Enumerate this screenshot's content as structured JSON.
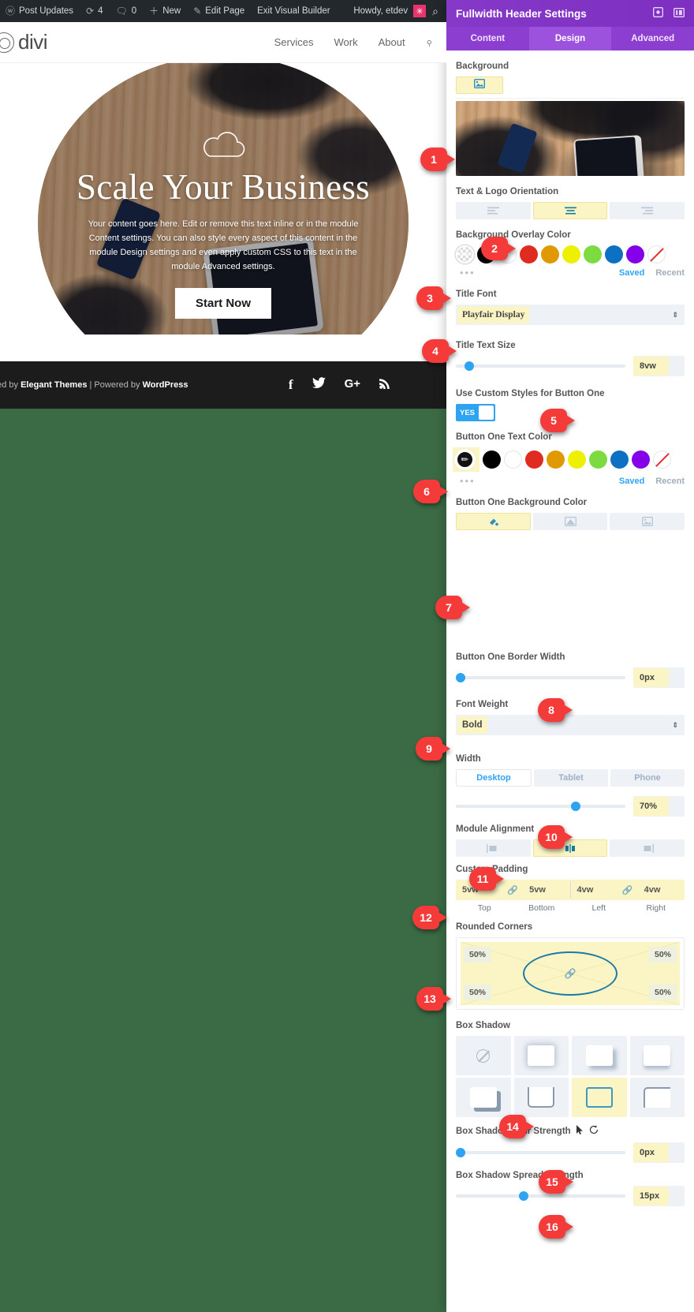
{
  "adminbar": {
    "items": [
      {
        "icon": "wordpress-logo-icon",
        "label": "Post Updates"
      },
      {
        "icon": "updates-icon",
        "label": "4"
      },
      {
        "icon": "comments-icon",
        "label": "0"
      },
      {
        "icon": "plus-icon",
        "label": "New"
      },
      {
        "icon": "pencil-icon",
        "label": "Edit Page"
      },
      {
        "icon": "",
        "label": "Exit Visual Builder"
      }
    ],
    "howdy": "Howdy, etdev",
    "avatar_glyph": "✳",
    "search_glyph": "⌕"
  },
  "site": {
    "logo": "divi",
    "nav": [
      "Services",
      "Work",
      "About"
    ],
    "search_glyph": "⌕",
    "hero": {
      "title": "Scale Your Business",
      "text": "Your content goes here. Edit or remove this text inline or in the module Content settings. You can also style every aspect of this content in the module Design settings and even apply custom CSS to this text in the module Advanced settings.",
      "button": "Start Now",
      "icon": "cloud-icon"
    },
    "footer": {
      "credit_pre": "ned by ",
      "credit_brand": "Elegant Themes",
      "credit_mid": " | Powered by ",
      "credit_cms": "WordPress",
      "social": [
        "facebook-icon",
        "twitter-icon",
        "google-plus-icon",
        "rss-icon"
      ],
      "social_glyphs": [
        "f",
        "🐦",
        "G+",
        "⌁"
      ]
    }
  },
  "panel": {
    "title": "Fullwidth Header Settings",
    "header_icons": [
      "fullscreen-icon",
      "layout-icon"
    ],
    "tabs": [
      {
        "label": "Content",
        "active": false
      },
      {
        "label": "Design",
        "active": true
      },
      {
        "label": "Advanced",
        "active": false
      }
    ],
    "fields": {
      "background": {
        "label": "Background",
        "tabs": [
          "image-icon"
        ],
        "preview_alt": "background image preview"
      },
      "text_logo_orientation": {
        "label": "Text & Logo Orientation",
        "options": [
          "align-left-icon",
          "align-center-icon",
          "align-right-icon"
        ],
        "selected_index": 1
      },
      "background_overlay_color": {
        "label": "Background Overlay Color",
        "swatches": [
          "transparent",
          "#000000",
          "#ffffff",
          "#e02b20",
          "#e09900",
          "#edf000",
          "#7cdb41",
          "#0c71c3",
          "#8300e9",
          "none"
        ],
        "selected_index": 0,
        "saved_label": "Saved",
        "recent_label": "Recent",
        "more_label": "•••"
      },
      "title_font": {
        "label": "Title Font",
        "value": "Playfair Display"
      },
      "title_text_size": {
        "label": "Title Text Size",
        "value": "8vw",
        "slider_pct": 5
      },
      "use_custom_styles_button_one": {
        "label": "Use Custom Styles for Button One",
        "toggle_label": "YES",
        "value": true
      },
      "button_one_text_color": {
        "label": "Button One Text Color",
        "swatches": [
          "#000000",
          "#000000",
          "#ffffff",
          "#e02b20",
          "#e09900",
          "#edf000",
          "#7cdb41",
          "#0c71c3",
          "#8300e9",
          "none"
        ],
        "selected_index": 0,
        "saved_label": "Saved",
        "recent_label": "Recent",
        "more_label": "•••"
      },
      "button_one_background_color": {
        "label": "Button One Background Color",
        "options": [
          "color-icon",
          "gradient-icon",
          "image-icon"
        ],
        "selected_index": 0
      },
      "button_one_border_width": {
        "label": "Button One Border Width",
        "value": "0px",
        "slider_pct": 0
      },
      "font_weight": {
        "label": "Font Weight",
        "value": "Bold"
      },
      "width": {
        "label": "Width",
        "devices": [
          "Desktop",
          "Tablet",
          "Phone"
        ],
        "selected_device": 0,
        "value": "70%",
        "slider_pct": 70
      },
      "module_alignment": {
        "label": "Module Alignment",
        "options": [
          "align-left-icon",
          "align-center-icon",
          "align-right-icon"
        ],
        "selected_index": 1
      },
      "custom_padding": {
        "label": "Custom Padding",
        "values": [
          "5vw",
          "5vw",
          "4vw",
          "4vw"
        ],
        "labels": [
          "Top",
          "Bottom",
          "Left",
          "Right"
        ],
        "link_icon": "link-icon"
      },
      "rounded_corners": {
        "label": "Rounded Corners",
        "values": [
          "50%",
          "50%",
          "50%",
          "50%"
        ],
        "link_icon": "link-icon"
      },
      "box_shadow": {
        "label": "Box Shadow",
        "options": [
          "none-icon",
          "shadow-soft-icon",
          "shadow-bottom-right-icon",
          "shadow-bottom-icon",
          "shadow-corner-icon",
          "shadow-outline-bottom-icon",
          "shadow-inset-icon",
          "shadow-top-left-icon"
        ],
        "selected_index": 6
      },
      "box_shadow_blur_strength": {
        "label": "Box Shadow Blur Strength",
        "value": "0px",
        "slider_pct": 0,
        "icons": [
          "cursor-icon",
          "reset-icon"
        ]
      },
      "box_shadow_spread_strength": {
        "label": "Box Shadow Spread Strength",
        "value": "15px",
        "slider_pct": 38
      }
    }
  },
  "callouts": [
    {
      "n": "1"
    },
    {
      "n": "2"
    },
    {
      "n": "3"
    },
    {
      "n": "4"
    },
    {
      "n": "5"
    },
    {
      "n": "6"
    },
    {
      "n": "7"
    },
    {
      "n": "8"
    },
    {
      "n": "9"
    },
    {
      "n": "10"
    },
    {
      "n": "11"
    },
    {
      "n": "12"
    },
    {
      "n": "13"
    },
    {
      "n": "14"
    },
    {
      "n": "15"
    },
    {
      "n": "16"
    }
  ],
  "colors": {
    "accent": "#2ea3f2",
    "panel_purple": "#8638c9",
    "callout_red": "#f43b39",
    "highlight_yellow": "#fbf5c5",
    "green_backdrop": "#3b6b45"
  }
}
